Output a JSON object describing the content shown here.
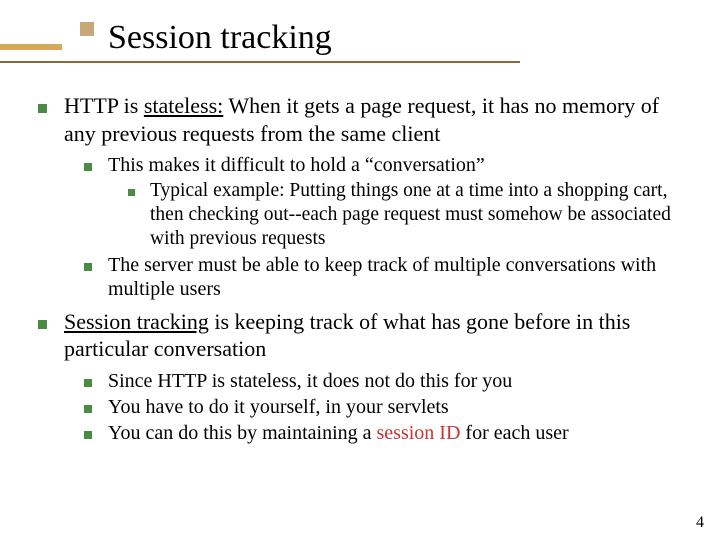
{
  "title": "Session tracking",
  "page_number": "4",
  "bullets": {
    "b1_pre": "HTTP is ",
    "b1_u": "stateless:",
    "b1_mid": " When it gets a page request, it has ",
    "b1_em1": "no memory",
    "b1_post": " of any previous requests from the same client",
    "b1a": "This makes it difficult to hold a “conversation”",
    "b1a1": "Typical example: Putting things one at a time into a shopping cart, then checking out--each page request must somehow be associated with previous requests",
    "b1b": "The server must be able to keep track of multiple conversations with multiple users",
    "b2_u": "Session tracking",
    "b2_post": " is keeping track of what has gone before in this particular conversation",
    "b2a": "Since HTTP is stateless, it does not do this for you",
    "b2b": "You have to do it yourself, in your servlets",
    "b2c_pre": "You can do this by maintaining a ",
    "b2c_red": "session ID",
    "b2c_post": " for each user"
  }
}
